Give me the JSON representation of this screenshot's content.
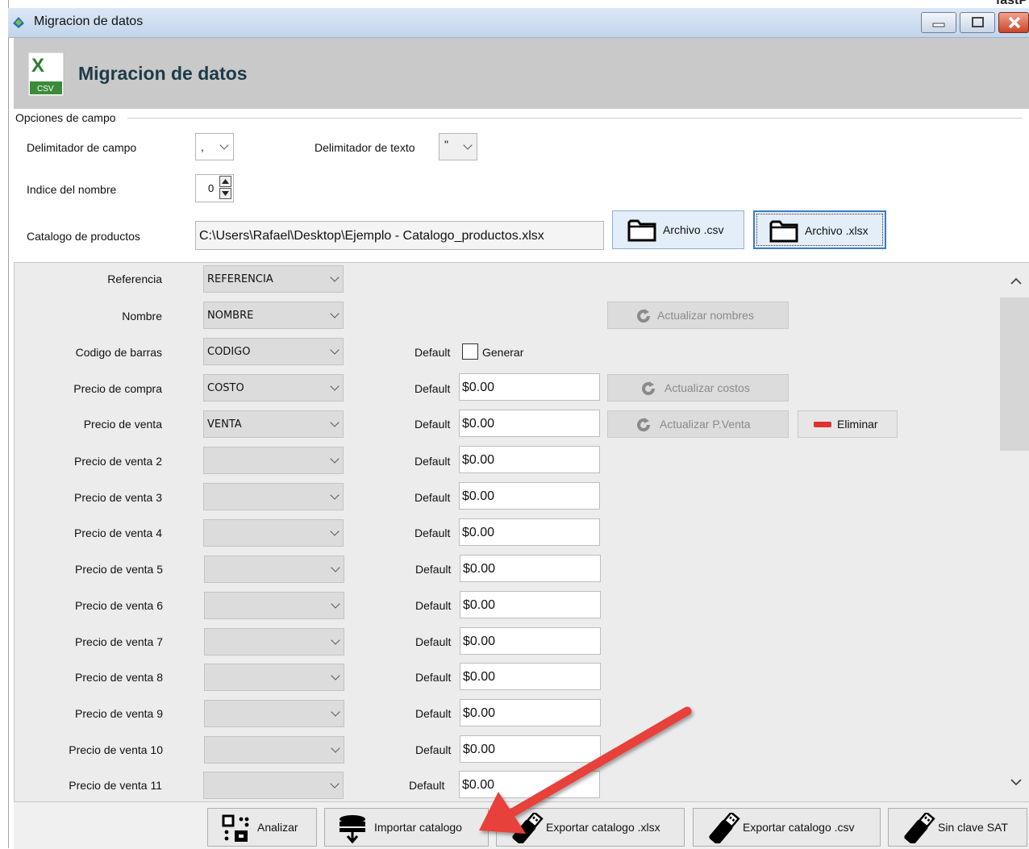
{
  "window": {
    "title": "Migracion de datos",
    "corner_text": "fastP"
  },
  "header": {
    "title": "Migracion de datos",
    "app_icon": "excel-csv-icon",
    "app_icon_text": "CSV"
  },
  "options": {
    "section_label": "Opciones de campo",
    "field_delimiter_label": "Delimitador de campo",
    "field_delimiter_value": ",",
    "text_delimiter_label": "Delimitador de texto",
    "text_delimiter_value": "\"",
    "name_index_label": "Indice del nombre",
    "name_index_value": "0",
    "catalog_label": "Catalogo de productos",
    "catalog_path": "C:\\Users\\Rafael\\Desktop\\Ejemplo - Catalogo_productos.xlsx",
    "btn_csv": "Archivo .csv",
    "btn_xlsx": "Archivo .xlsx"
  },
  "mapping": {
    "default_label": "Default",
    "generate_label": "Generar",
    "rows": [
      {
        "label": "Referencia",
        "column": "REFERENCIA"
      },
      {
        "label": "Nombre",
        "column": "NOMBRE"
      },
      {
        "label": "Codigo de barras",
        "column": "CODIGO"
      },
      {
        "label": "Precio de compra",
        "column": "COSTO",
        "default": "$0.00"
      },
      {
        "label": "Precio de venta",
        "column": "VENTA",
        "default": "$0.00"
      },
      {
        "label": "Precio de venta 2",
        "column": "",
        "default": "$0.00"
      },
      {
        "label": "Precio de venta 3",
        "column": "",
        "default": "$0.00"
      },
      {
        "label": "Precio de venta 4",
        "column": "",
        "default": "$0.00"
      },
      {
        "label": "Precio de venta 5",
        "column": "",
        "default": "$0.00"
      },
      {
        "label": "Precio de venta 6",
        "column": "",
        "default": "$0.00"
      },
      {
        "label": "Precio de venta 7",
        "column": "",
        "default": "$0.00"
      },
      {
        "label": "Precio de venta 8",
        "column": "",
        "default": "$0.00"
      },
      {
        "label": "Precio de venta 9",
        "column": "",
        "default": "$0.00"
      },
      {
        "label": "Precio de venta 10",
        "column": "",
        "default": "$0.00"
      },
      {
        "label": "Precio de venta 11",
        "column": "",
        "default": "$0.00"
      }
    ],
    "btn_update_names": "Actualizar nombres",
    "btn_update_costs": "Actualizar costos",
    "btn_update_price": "Actualizar P.Venta",
    "btn_delete": "Eliminar"
  },
  "toolbar": {
    "analyze": "Analizar",
    "import": "Importar catalogo",
    "export_xlsx": "Exportar catalogo .xlsx",
    "export_csv": "Exportar catalogo .csv",
    "sin_clave": "Sin clave SAT"
  },
  "colors": {
    "annotation_arrow": "#e8413b",
    "delete_icon": "#e03030",
    "header_title": "#1c3b48"
  }
}
